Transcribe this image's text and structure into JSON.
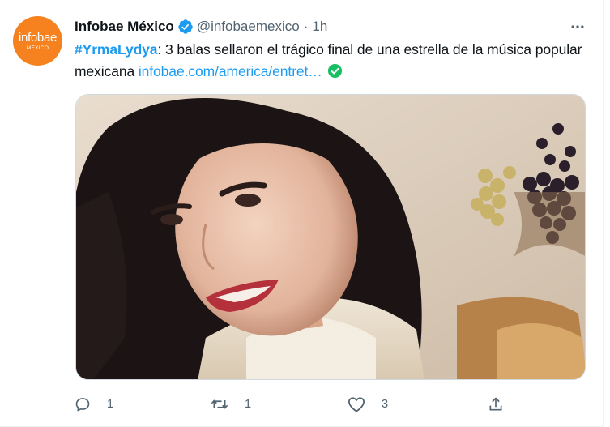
{
  "account": {
    "avatar_brand": "infobae",
    "avatar_sub": "MÉXICO",
    "name": "Infobae México",
    "handle": "@infobaemexico",
    "separator": "·",
    "time": "1h"
  },
  "tweet": {
    "hashtag": "#YrmaLydya",
    "text": ": 3 balas sellaron el trágico final de una estrella de la música popular mexicana ",
    "link": "infobae.com/america/entret…"
  },
  "actions": {
    "reply_count": "1",
    "retweet_count": "1",
    "like_count": "3"
  },
  "icons": [
    "verified-icon",
    "more-icon",
    "check-circle-icon",
    "reply-icon",
    "retweet-icon",
    "like-icon",
    "share-icon"
  ],
  "colors": {
    "brand": "#f5821f",
    "link": "#1d9bf0",
    "verified": "#1d9bf0",
    "check": "#17bf63",
    "muted": "#536471"
  }
}
